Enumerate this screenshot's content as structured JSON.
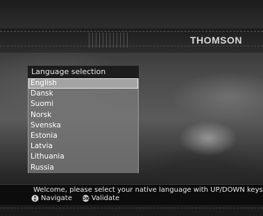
{
  "brand": {
    "name": "THOMSON"
  },
  "menu": {
    "title": "Language selection",
    "selected_index": 0,
    "items": [
      {
        "label": "English"
      },
      {
        "label": "Dansk"
      },
      {
        "label": "Suomi"
      },
      {
        "label": "Norsk"
      },
      {
        "label": "Svenska"
      },
      {
        "label": "Estonia"
      },
      {
        "label": "Latvia"
      },
      {
        "label": "Lithuania"
      },
      {
        "label": "Russia"
      }
    ]
  },
  "help": {
    "text": "Welcome, please select your native language with UP/DOWN keys.",
    "legend": [
      {
        "icon": "navigate-icon",
        "label": "Navigate"
      },
      {
        "icon": "validate-icon",
        "label": "Validate"
      }
    ]
  }
}
